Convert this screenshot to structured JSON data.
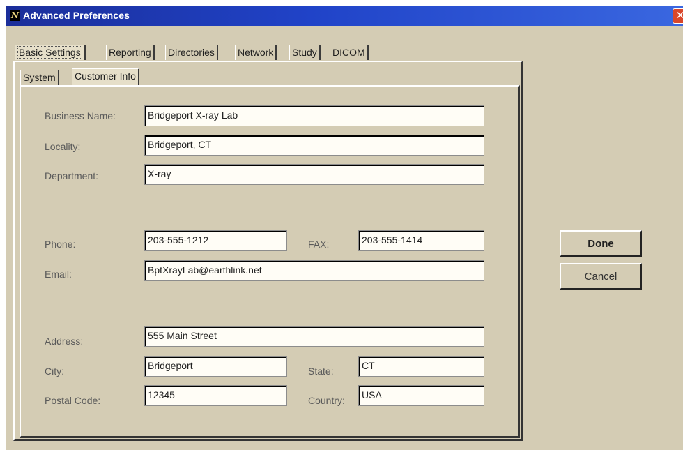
{
  "window": {
    "title": "Advanced Preferences",
    "icon": "N",
    "close_glyph": "✕"
  },
  "tabs": [
    {
      "label": "Basic Settings",
      "active": true
    },
    {
      "label": "Reporting"
    },
    {
      "label": "Directories"
    },
    {
      "label": "Network"
    },
    {
      "label": "Study"
    },
    {
      "label": "DICOM"
    }
  ],
  "subtabs": [
    {
      "label": "System"
    },
    {
      "label": "Customer Info",
      "active": true
    }
  ],
  "form": {
    "business_name": {
      "label": "Business Name:",
      "value": "Bridgeport X-ray Lab"
    },
    "locality": {
      "label": "Locality:",
      "value": "Bridgeport, CT"
    },
    "department": {
      "label": "Department:",
      "value": "X-ray"
    },
    "phone": {
      "label": "Phone:",
      "value": "203-555-1212"
    },
    "fax": {
      "label": "FAX:",
      "value": "203-555-1414"
    },
    "email": {
      "label": "Email:",
      "value": "BptXrayLab@earthlink.net"
    },
    "address": {
      "label": "Address:",
      "value": "555 Main Street"
    },
    "city": {
      "label": "City:",
      "value": "Bridgeport"
    },
    "state": {
      "label": "State:",
      "value": "CT"
    },
    "postal_code": {
      "label": "Postal Code:",
      "value": "12345"
    },
    "country": {
      "label": "Country:",
      "value": "USA"
    }
  },
  "buttons": {
    "done": "Done",
    "cancel": "Cancel"
  }
}
